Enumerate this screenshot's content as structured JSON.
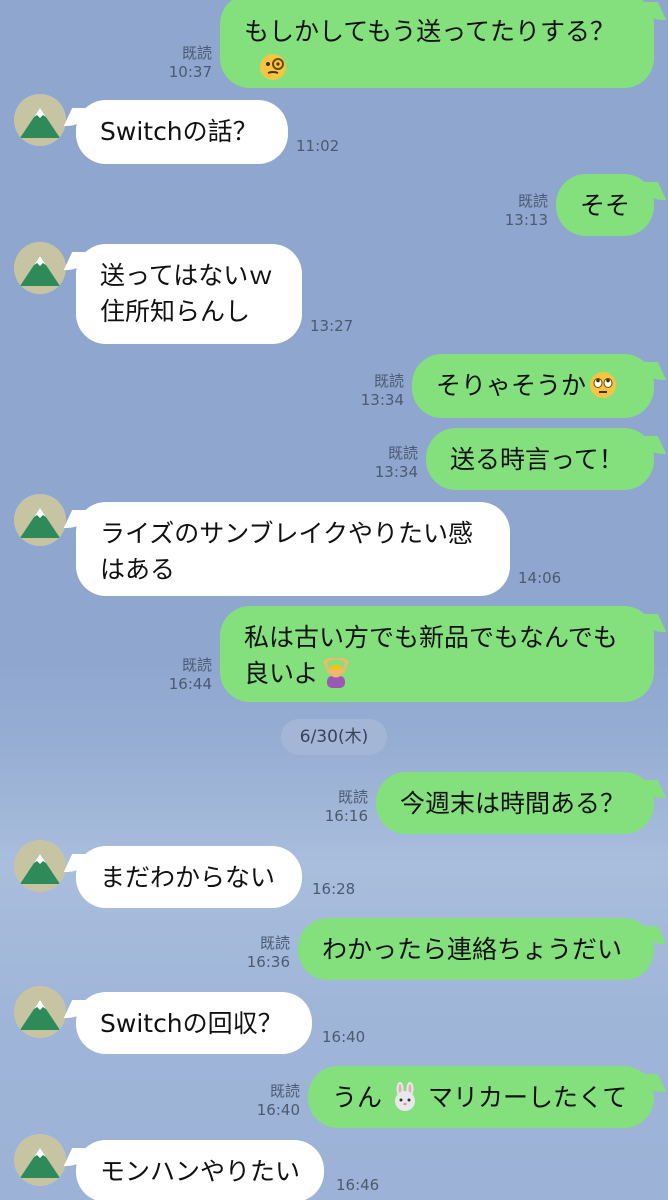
{
  "messages": [
    {
      "id": "m1",
      "dir": "out",
      "lines": [
        "もしかしてもう送ってたりする？"
      ],
      "emoji": "monocle-face-emoji",
      "read": "既読",
      "time": "10:37"
    },
    {
      "id": "m2",
      "dir": "in",
      "lines": [
        "Switchの話？"
      ],
      "time": "11:02"
    },
    {
      "id": "m3",
      "dir": "out",
      "lines": [
        "そそ"
      ],
      "read": "既読",
      "time": "13:13"
    },
    {
      "id": "m4",
      "dir": "in",
      "lines": [
        "送ってはないｗ",
        "住所知らんし"
      ],
      "time": "13:27"
    },
    {
      "id": "m5",
      "dir": "out",
      "lines": [
        "そりゃそうか"
      ],
      "emoji": "eye-roll-emoji",
      "read": "既読",
      "time": "13:34"
    },
    {
      "id": "m6",
      "dir": "out",
      "lines": [
        "送る時言って！"
      ],
      "read": "既読",
      "time": "13:34"
    },
    {
      "id": "m7",
      "dir": "in",
      "lines": [
        "ライズのサンブレイクやりたい感",
        "はある"
      ],
      "time": "14:06"
    },
    {
      "id": "m8",
      "dir": "out",
      "lines": [
        "私は古い方でも新品でもなんでも",
        "良いよ"
      ],
      "emoji": "ok-gesture-emoji",
      "read": "既読",
      "time": "16:44"
    },
    {
      "id": "m9",
      "dir": "out",
      "lines": [
        "今週末は時間ある？"
      ],
      "read": "既読",
      "time": "16:16"
    },
    {
      "id": "m10",
      "dir": "in",
      "lines": [
        "まだわからない"
      ],
      "time": "16:28"
    },
    {
      "id": "m11",
      "dir": "out",
      "lines": [
        "わかったら連絡ちょうだい"
      ],
      "read": "既読",
      "time": "16:36"
    },
    {
      "id": "m12",
      "dir": "in",
      "lines": [
        "Switchの回収？"
      ],
      "time": "16:40"
    },
    {
      "id": "m13",
      "dir": "out",
      "lines": [
        "うん",
        "マリカーしたくて"
      ],
      "emoji": "rabbit-face-emoji",
      "read": "既読",
      "time": "16:40"
    },
    {
      "id": "m14",
      "dir": "in",
      "lines": [
        "モンハンやりたい"
      ],
      "time": "16:46"
    }
  ],
  "date_separator": "6/30(木)",
  "avatar_icon": "mountain-avatar-icon",
  "colors": {
    "background": "#8fa6cf",
    "outgoing_bubble": "#84e07d",
    "incoming_bubble": "#ffffff",
    "meta_text": "#4b5a73"
  }
}
